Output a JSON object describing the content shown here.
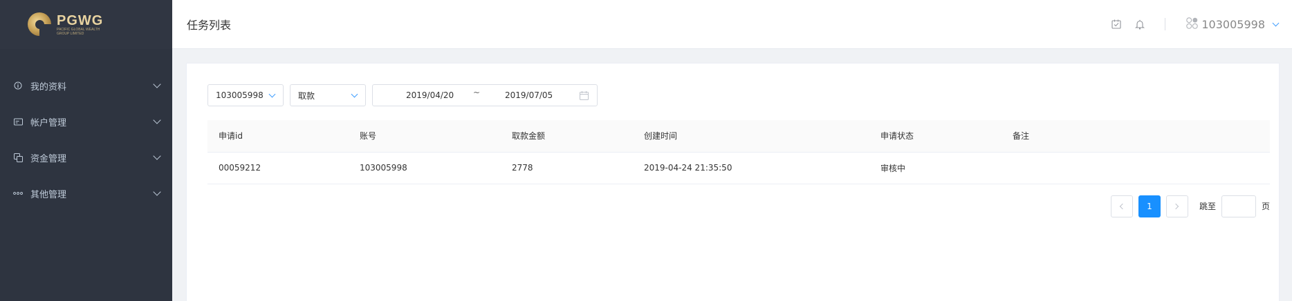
{
  "brand": {
    "name": "PGWG",
    "subtitle": "PACIFIC GLOBAL WEALTH GROUP LIMITED"
  },
  "sidebar": {
    "items": [
      {
        "label": "我的资料",
        "icon": "info-icon"
      },
      {
        "label": "帐户管理",
        "icon": "card-icon"
      },
      {
        "label": "资金管理",
        "icon": "funds-icon"
      },
      {
        "label": "其他管理",
        "icon": "more-dots-icon"
      }
    ]
  },
  "header": {
    "title": "任务列表",
    "username": "103005998"
  },
  "filters": {
    "account": "103005998",
    "type": "取款",
    "date_start": "2019/04/20",
    "date_separator": "~",
    "date_end": "2019/07/05"
  },
  "table": {
    "columns": [
      "申请id",
      "账号",
      "取款金额",
      "创建时间",
      "申请状态",
      "备注"
    ],
    "rows": [
      [
        "00059212",
        "103005998",
        "2778",
        "2019-04-24 21:35:50",
        "审核中",
        ""
      ]
    ]
  },
  "pagination": {
    "current_page": "1",
    "goto_label": "跳至",
    "page_suffix": "页",
    "goto_value": ""
  },
  "colors": {
    "sidebar_bg": "#2e3440",
    "accent": "#1890ff",
    "chevron_blue": "#409eff"
  }
}
